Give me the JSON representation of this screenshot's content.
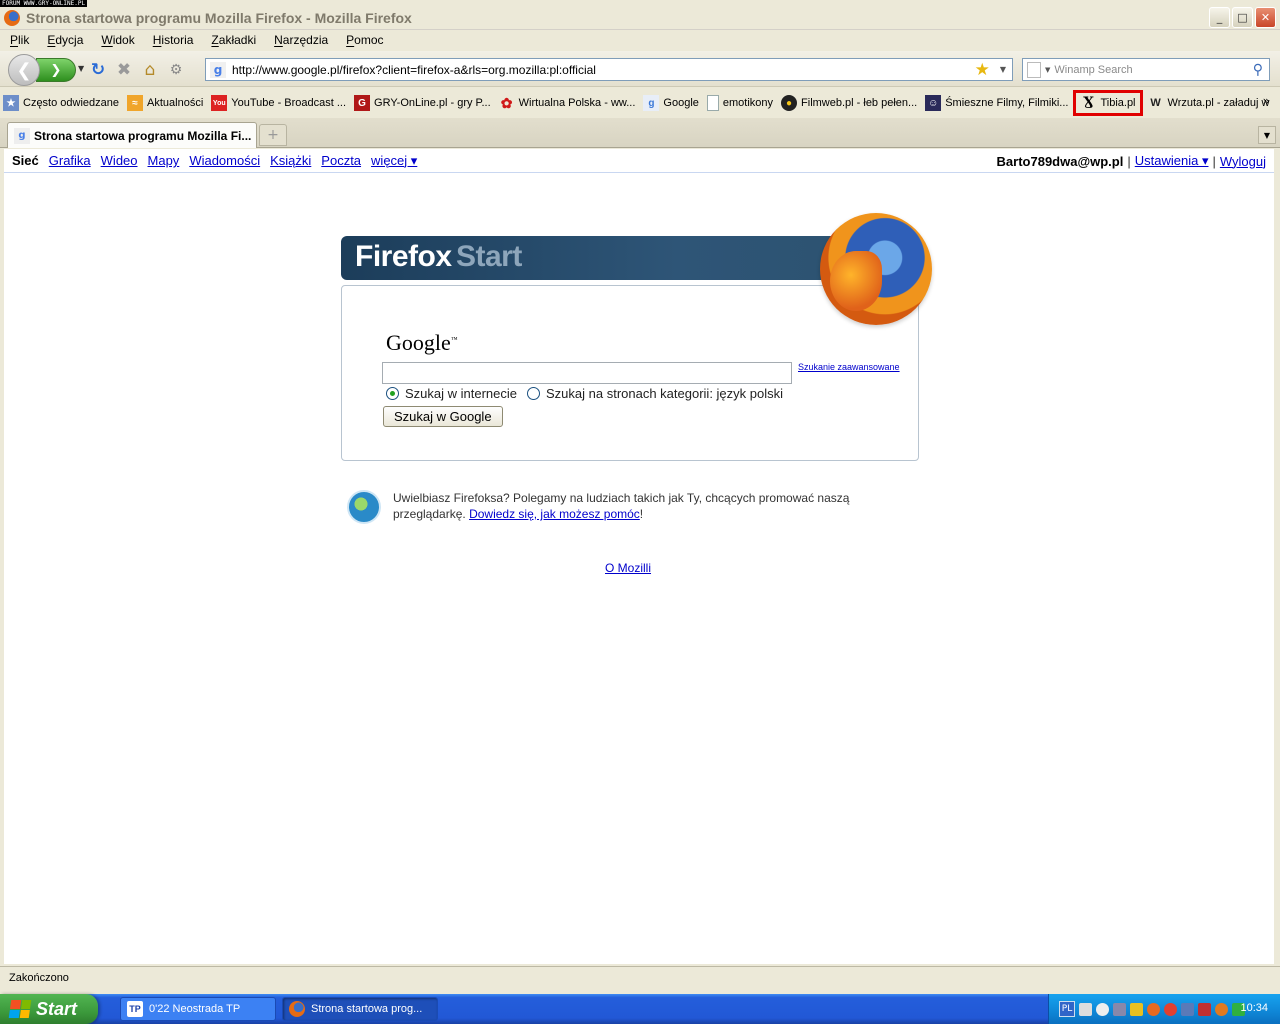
{
  "watermark": "FORUM WWW.GRY-ONLINE.PL",
  "window": {
    "title": "Strona startowa programu Mozilla Firefox - Mozilla Firefox",
    "minimize": "_",
    "maximize": "□",
    "close": "✕"
  },
  "menu": [
    "Plik",
    "Edycja",
    "Widok",
    "Historia",
    "Zakładki",
    "Narzędzia",
    "Pomoc"
  ],
  "navbar": {
    "url": "http://www.google.pl/firefox?client=firefox-a&rls=org.mozilla:pl:official",
    "search_placeholder": "Winamp Search"
  },
  "bookmarks": [
    {
      "label": "Często odwiedzane",
      "icon": "star-folder-icon"
    },
    {
      "label": "Aktualności",
      "icon": "rss-icon"
    },
    {
      "label": "YouTube - Broadcast ...",
      "icon": "youtube-icon"
    },
    {
      "label": "GRY-OnLine.pl - gry P...",
      "icon": "gry-online-icon"
    },
    {
      "label": "Wirtualna Polska - ww...",
      "icon": "wp-icon"
    },
    {
      "label": "Google",
      "icon": "google-icon"
    },
    {
      "label": "emotikony",
      "icon": "page-icon"
    },
    {
      "label": "Filmweb.pl - łeb pełen...",
      "icon": "filmweb-icon"
    },
    {
      "label": "Śmieszne Filmy, Filmiki...",
      "icon": "smieszne-icon"
    },
    {
      "label": "Tibia.pl",
      "icon": "tibia-icon",
      "highlighted": true
    },
    {
      "label": "Wrzuta.pl - załaduj w",
      "icon": "wrzuta-icon"
    }
  ],
  "tab": {
    "label": "Strona startowa programu Mozilla Fi...",
    "new_tab": "+"
  },
  "gbar": {
    "current": "Sieć",
    "links": [
      "Grafika",
      "Wideo",
      "Mapy",
      "Wiadomości",
      "Książki",
      "Poczta",
      "więcej ▾"
    ],
    "email": "Barto789dwa@wp.pl",
    "settings": "Ustawienia ▾",
    "logout": "Wyloguj",
    "separator": "|"
  },
  "start": {
    "title_bold": "Firefox",
    "title_light": "Start",
    "google_logo": "Google",
    "google_tm": "™",
    "advanced_link": "Szukanie zaawansowane",
    "radio_web": "Szukaj w internecie",
    "radio_lang": "Szukaj na stronach kategorii: język polski",
    "search_button": "Szukaj w Google",
    "promo_text": "Uwielbiasz Firefoksa? Polegamy na ludziach takich jak Ty, chcących promować naszą przeglądarkę.",
    "promo_link": "Dowiedz się, jak możesz pomóc",
    "promo_end": "!",
    "about_link": "O Mozilli"
  },
  "status": "Zakończono",
  "taskbar": {
    "start": "Start",
    "items": [
      {
        "label": "0'22 Neostrada TP",
        "icon": "tp-icon",
        "badge": "TP"
      },
      {
        "label": "Strona startowa prog...",
        "icon": "firefox-icon",
        "badge": ""
      }
    ],
    "lang": "PL",
    "clock": "10:34"
  }
}
